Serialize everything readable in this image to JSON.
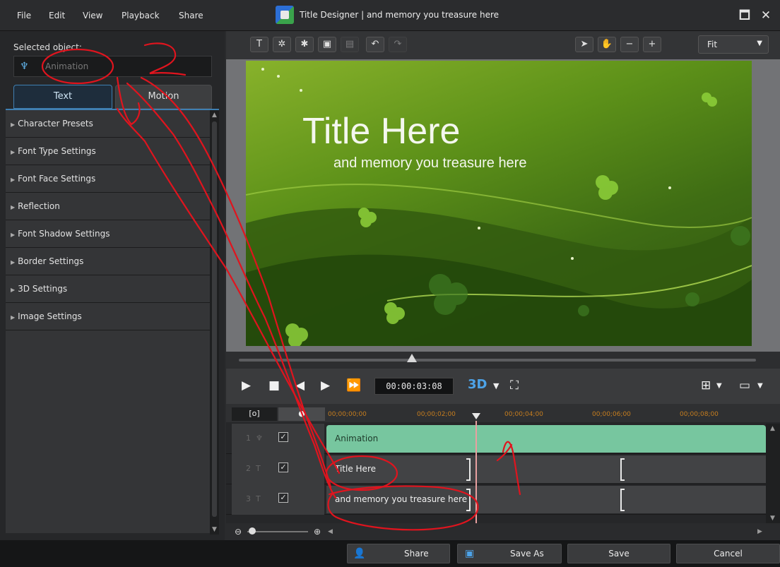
{
  "menu": {
    "file": "File",
    "edit": "Edit",
    "view": "View",
    "playback": "Playback",
    "share": "Share"
  },
  "window": {
    "title": "Title Designer | and memory you treasure here",
    "maximize_glyph": "🗖",
    "close_glyph": "✕"
  },
  "left_panel": {
    "selected_label": "Selected object:",
    "selected_value": "Animation",
    "tabs": {
      "text": "Text",
      "motion": "Motion"
    },
    "sections": [
      "Character Presets",
      "Font Type Settings",
      "Font Face Settings",
      "Reflection",
      "Font Shadow Settings",
      "Border Settings",
      "3D Settings",
      "Image Settings"
    ]
  },
  "toolbar": {
    "fit": "Fit"
  },
  "preview": {
    "title": "Title Here",
    "subtitle": "and memory you treasure here"
  },
  "playback": {
    "timecode": "00:00:03:08",
    "mode": "3D"
  },
  "timeline": {
    "ruler": [
      "00;00;00;00",
      "00;00;02;00",
      "00;00;04;00",
      "00;00;06;00",
      "00;00;08;00"
    ],
    "tracks": [
      {
        "num": "1",
        "clip": "Animation"
      },
      {
        "num": "2",
        "clip": "Title Here"
      },
      {
        "num": "3",
        "clip": "and memory you treasure here"
      }
    ]
  },
  "bottom": {
    "share": "Share",
    "save_as": "Save As",
    "save": "Save",
    "cancel": "Cancel"
  },
  "colors": {
    "accent": "#3f7fb1",
    "clip_green": "#77c69f",
    "annotation": "#e0141e"
  }
}
